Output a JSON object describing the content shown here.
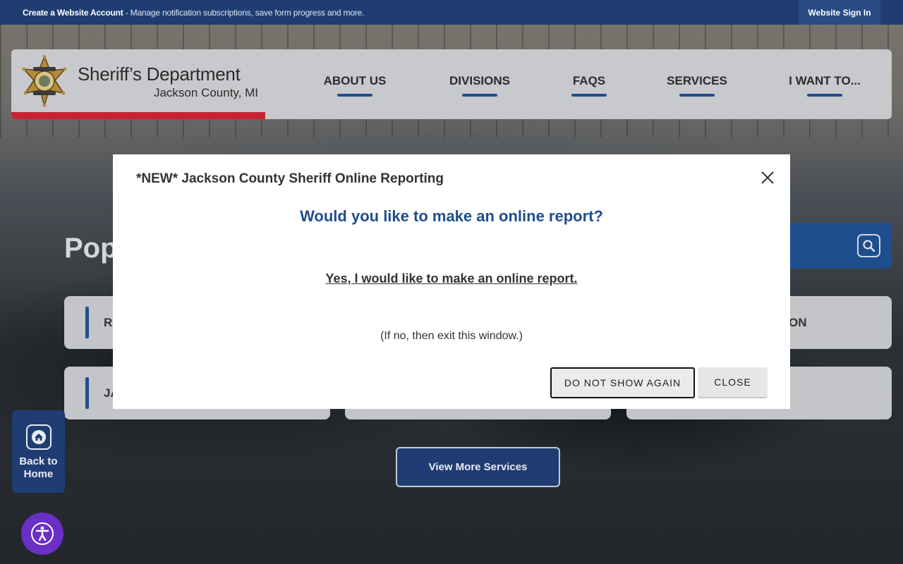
{
  "topbar": {
    "account_link": "Create a Website Account",
    "account_desc": " - Manage notification subscriptions, save form progress and more.",
    "signin": "Website Sign In"
  },
  "header": {
    "title": "Sheriff’s Department",
    "subtitle": "Jackson County, MI",
    "nav": [
      "ABOUT US",
      "DIVISIONS",
      "FAQS",
      "SERVICES",
      "I WANT TO..."
    ]
  },
  "background": {
    "popular_title": "Pop",
    "card_left_1": "R",
    "card_left_2": "JA",
    "card_right_1": "ON",
    "view_more": "View More Services",
    "back_home": "Back to Home"
  },
  "modal": {
    "title": "*NEW* Jackson County Sheriff Online Reporting",
    "heading": "Would you like to make an online report?",
    "link": "Yes, I would like to make an online report.",
    "note": "(If no, then exit this window.)",
    "btn_do_not_show": "DO NOT SHOW AGAIN",
    "btn_close": "CLOSE"
  },
  "colors": {
    "brand_blue": "#1f3d72",
    "accent_blue": "#1f4e8f",
    "accent_red": "#c9232f",
    "a11y_purple": "#6a2fc4"
  },
  "icons": {
    "badge": "sheriff-star-badge-icon",
    "search": "search-icon",
    "close": "close-icon",
    "home": "home-icon",
    "accessibility": "accessibility-icon"
  }
}
